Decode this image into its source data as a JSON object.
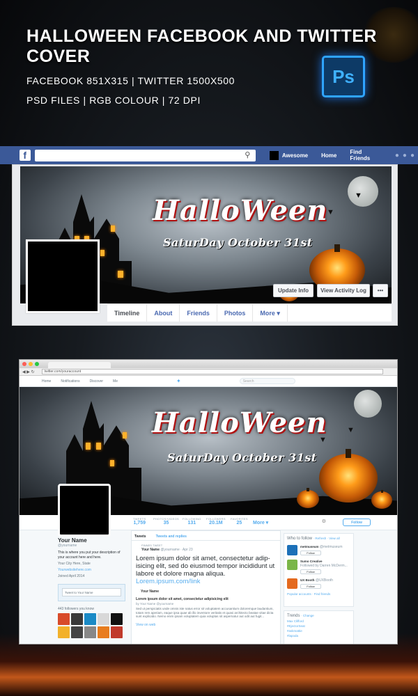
{
  "header": {
    "title": "HALLOWEEN FACEBOOK AND TWITTER COVER",
    "line1": "FACEBOOK  851X315  | TWITTER  1500X500",
    "line2": "PSD FILES | RGB COLOUR | 72 DPI",
    "badge": "Ps"
  },
  "facebook": {
    "logo": "f",
    "user_name": "Awesome",
    "nav": [
      "Home",
      "Find Friends"
    ],
    "cover_title": "HalloWeen",
    "cover_subtitle": "SaturDay October 31st",
    "buttons": {
      "update": "Update Info",
      "activity": "View Activity Log",
      "more": "•••"
    },
    "tabs": [
      "Timeline",
      "About",
      "Friends",
      "Photos",
      "More ▾"
    ]
  },
  "twitter": {
    "address": "twitter.com/youraccount",
    "nav": [
      "Home",
      "Notifications",
      "Discover",
      "Me"
    ],
    "search_placeholder": "Search",
    "cover_title": "HalloWeen",
    "cover_subtitle": "SaturDay October 31st",
    "stats": [
      {
        "label": "TWEETS",
        "value": "1,759"
      },
      {
        "label": "PHOTOS/VIDEOS",
        "value": "35"
      },
      {
        "label": "FOLLOWING",
        "value": "131"
      },
      {
        "label": "FOLLOWERS",
        "value": "20.1M"
      },
      {
        "label": "FAVORITES",
        "value": "25"
      },
      {
        "label": "",
        "value": "More ▾"
      }
    ],
    "follow_button": "Follow",
    "profile": {
      "name": "Your Name",
      "handle": "@yourname",
      "bio": "This is where you put your description of your account here and here.",
      "location": "Your City Here, State",
      "website": "Yourwebsitehere.com",
      "joined": "Joined April 2014",
      "tweet_to": "Tweet to Your Name",
      "followers_known": "443 followers you know"
    },
    "tabs": [
      "Tweets",
      "Tweets and replies"
    ],
    "pinned": "PINNED TWEET",
    "tweet_author": "Your Name",
    "tweet_handle": "@yourname · Apr 23",
    "tweet_text": "Lorem ipsum dolor sit amet, consectetur adip-isicing elit, sed do eiusmod tempor incididunt ut labore et dolore magna aliqua.",
    "tweet_link": "Lorem.ipsum.com/link",
    "card_name": "Your Name",
    "card_title": "Lorem ipsum dolor sit amet, consectetur adipisicing elit",
    "card_by": "by Your Name @yourname",
    "card_body": "Sed ut perspiciatis unde omnis iste natus error sit voluptatem accusantium doloremque laudantium, totam rem aperiam, eaque ipsa quae ab illo inventore veritatis et quasi architecto beatae vitae dicta sunt explicabo. Nemo enim ipsam voluptatem quia voluptas sit aspernatur aut odit aut fugit...",
    "view_on_web": "View on web",
    "who_to_follow": {
      "title": "Who to follow",
      "links": "· Refresh · View all",
      "items": [
        {
          "name": "metmuseum",
          "sub": "@metmuseum",
          "color": "#1c70b8"
        },
        {
          "name": "Sumo Creative",
          "sub": "Followed by Darren McDerm...",
          "color": "#7ab648"
        },
        {
          "name": "UX Booth",
          "sub": "@UXBooth",
          "color": "#e46a1f"
        }
      ],
      "follow_label": "Follow",
      "footer": "Popular accounts · Find friends"
    },
    "trends": {
      "title": "Trends",
      "change": "· Change",
      "items": [
        "Max Clifford",
        "#EjectorSeat",
        "#askmattie",
        "#lapoda"
      ]
    }
  }
}
